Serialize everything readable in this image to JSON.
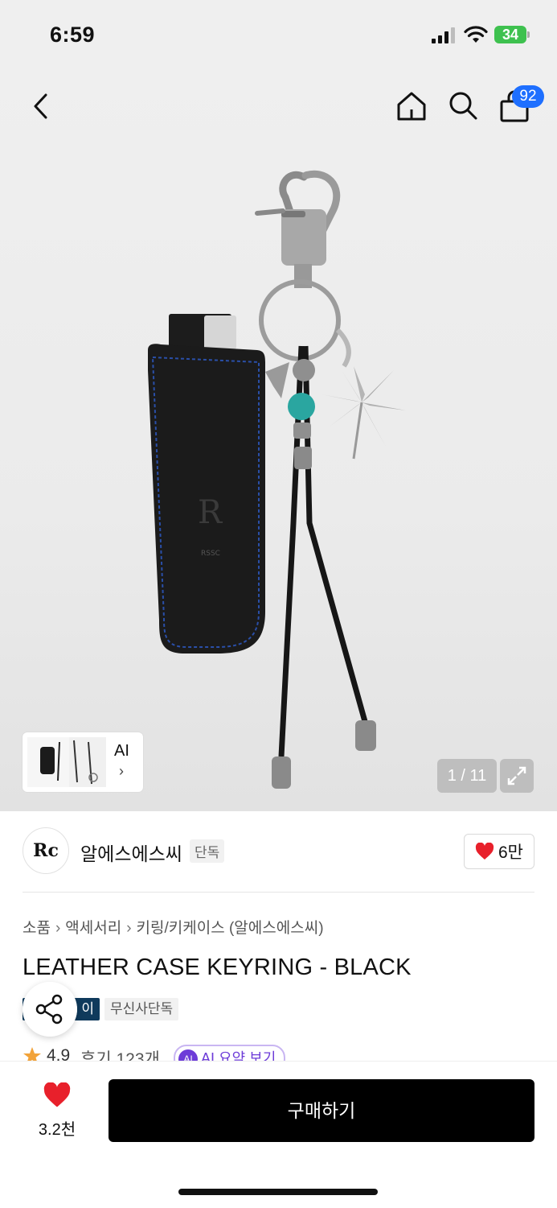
{
  "status": {
    "time": "6:59",
    "battery": "34"
  },
  "header": {
    "cart_count": "92"
  },
  "gallery": {
    "counter": "1 / 11",
    "ai_label": "AI"
  },
  "brand": {
    "logo_text": "Rc",
    "name": "알에스에스씨",
    "exclusive_badge": "단독",
    "likes": "6만"
  },
  "breadcrumb": [
    "소품",
    "액세서리",
    "키링/키케이스 (알에스에스씨)"
  ],
  "product": {
    "title": "LEATHER CASE KEYRING - BLACK",
    "tags": [
      "이",
      "무신사단독"
    ],
    "rating": "4.9",
    "reviews": "후기 123개",
    "ai_summary": "AI 요약 보기",
    "ai_summary_icon": "AI"
  },
  "footer": {
    "wish_count": "3.2천",
    "buy_label": "구매하기"
  },
  "colors": {
    "buy": "#000000",
    "badge": "#1e6fff",
    "heart": "#e8202b",
    "battery": "#3ec14f"
  }
}
